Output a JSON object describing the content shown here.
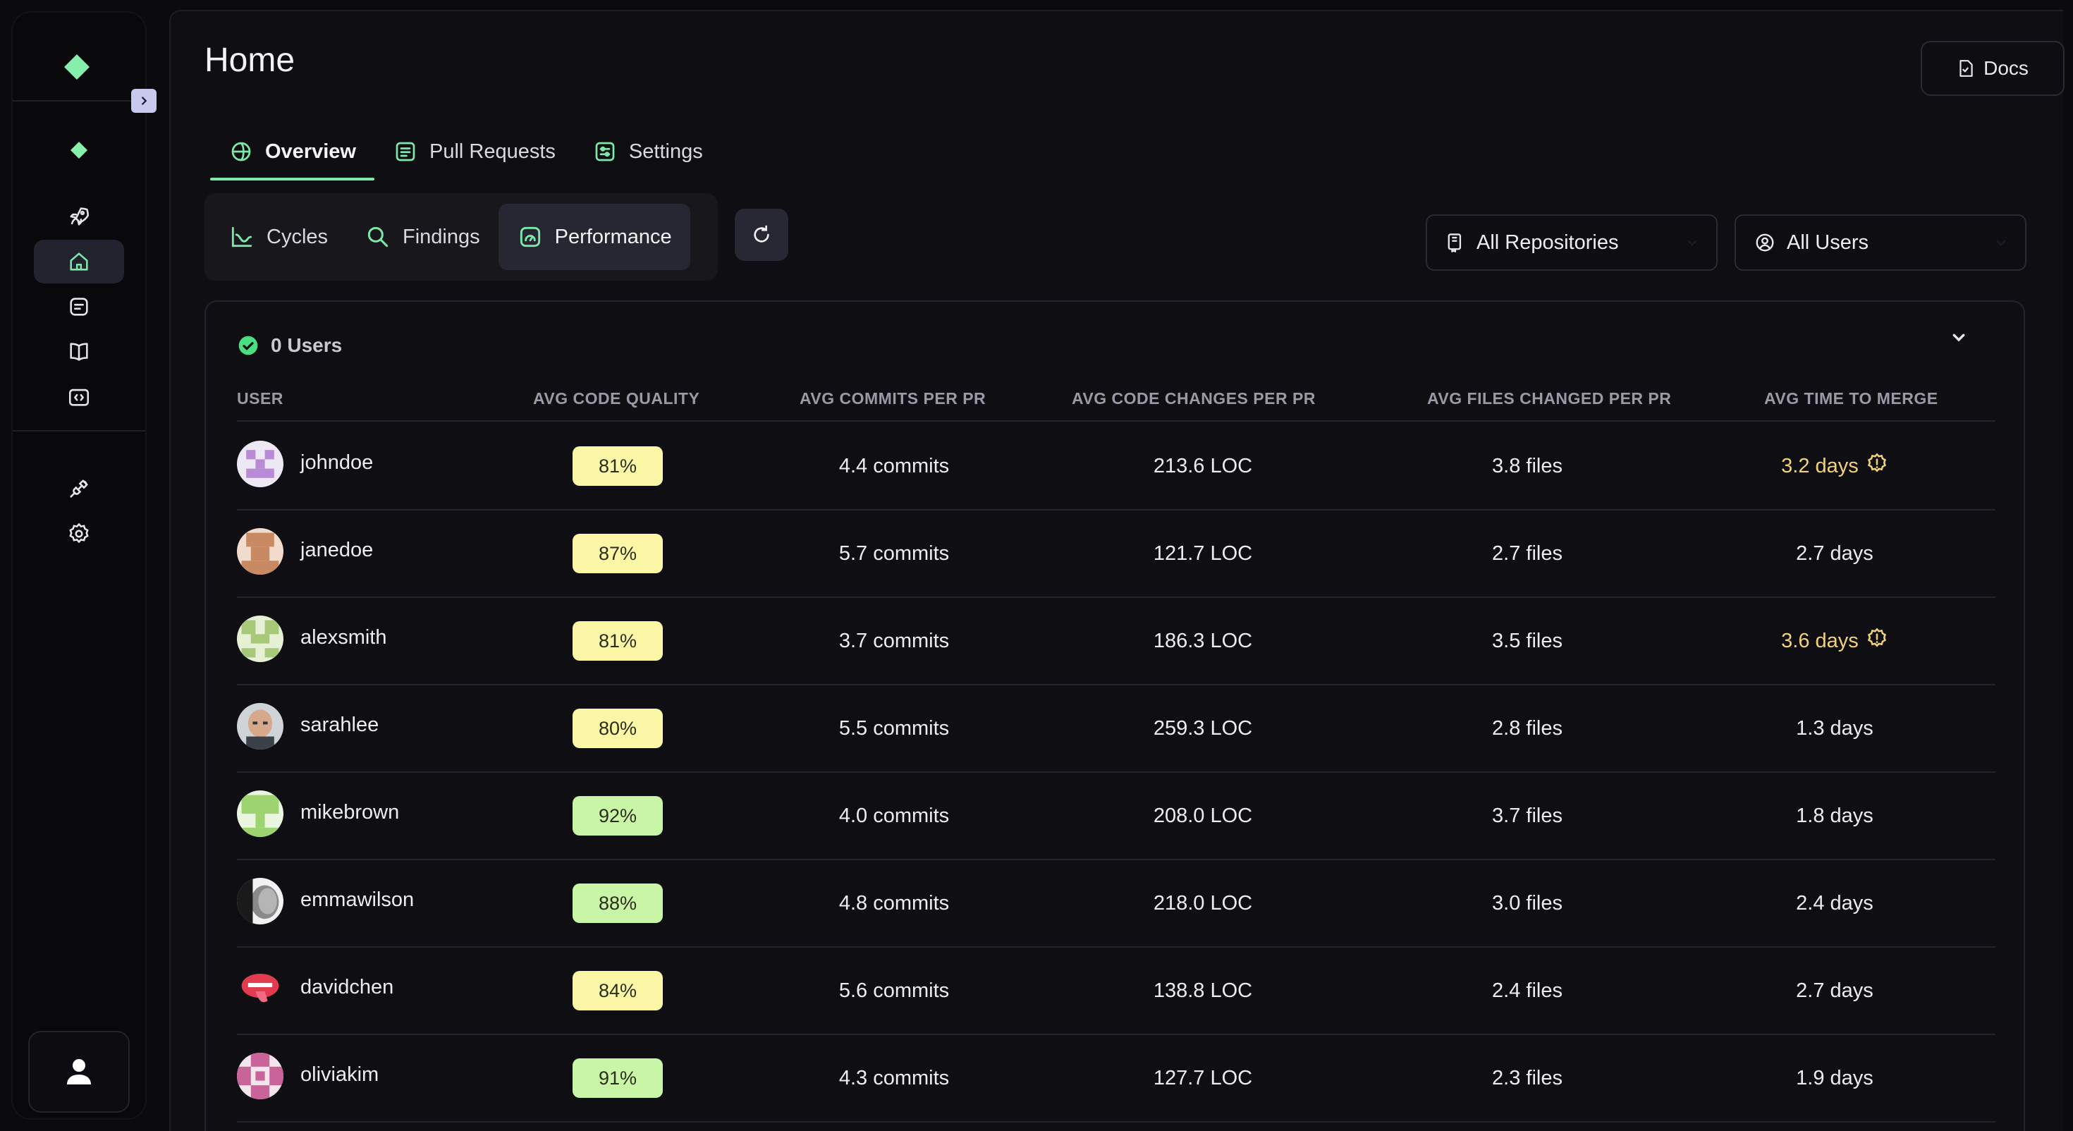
{
  "sidebar": {
    "nav_icons": [
      "logo-icon",
      "diamond-icon",
      "rocket-icon",
      "home-icon",
      "pull-requests-icon",
      "book-icon",
      "code-icon",
      "plug-icon",
      "gear-icon"
    ],
    "user_icon": "person-icon"
  },
  "page": {
    "title": "Home",
    "docs_label": "Docs"
  },
  "tabs": [
    {
      "label": "Overview",
      "active": true
    },
    {
      "label": "Pull Requests",
      "active": false
    },
    {
      "label": "Settings",
      "active": false
    }
  ],
  "segments": [
    {
      "label": "Cycles",
      "active": false
    },
    {
      "label": "Findings",
      "active": false
    },
    {
      "label": "Performance",
      "active": true
    }
  ],
  "filters": {
    "repositories": "All Repositories",
    "users": "All Users"
  },
  "table": {
    "summary": "0 Users",
    "columns": [
      "USER",
      "AVG CODE QUALITY",
      "AVG COMMITS PER PR",
      "AVG CODE CHANGES PER PR",
      "AVG FILES CHANGED PER PR",
      "AVG TIME TO MERGE"
    ],
    "rows": [
      {
        "user": "johndoe",
        "quality": "81%",
        "commits": "4.4 commits",
        "changes": "213.6 LOC",
        "files": "3.8 files",
        "merge": "3.2 days",
        "warn": true
      },
      {
        "user": "janedoe",
        "quality": "87%",
        "commits": "5.7 commits",
        "changes": "121.7 LOC",
        "files": "2.7 files",
        "merge": "2.7 days",
        "warn": false
      },
      {
        "user": "alexsmith",
        "quality": "81%",
        "commits": "3.7 commits",
        "changes": "186.3 LOC",
        "files": "3.5 files",
        "merge": "3.6 days",
        "warn": true
      },
      {
        "user": "sarahlee",
        "quality": "80%",
        "commits": "5.5 commits",
        "changes": "259.3 LOC",
        "files": "2.8 files",
        "merge": "1.3 days",
        "warn": false
      },
      {
        "user": "mikebrown",
        "quality": "92%",
        "commits": "4.0 commits",
        "changes": "208.0 LOC",
        "files": "3.7 files",
        "merge": "1.8 days",
        "warn": false
      },
      {
        "user": "emmawilson",
        "quality": "88%",
        "commits": "4.8 commits",
        "changes": "218.0 LOC",
        "files": "3.0 files",
        "merge": "2.4 days",
        "warn": false
      },
      {
        "user": "davidchen",
        "quality": "84%",
        "commits": "5.6 commits",
        "changes": "138.8 LOC",
        "files": "2.4 files",
        "merge": "2.7 days",
        "warn": false
      },
      {
        "user": "oliviakim",
        "quality": "91%",
        "commits": "4.3 commits",
        "changes": "127.7 LOC",
        "files": "2.3 files",
        "merge": "1.9 days",
        "warn": false
      }
    ]
  },
  "colors": {
    "accent": "#7de8a8",
    "badge_yellow": "#fbf7a6",
    "badge_green": "#c9f5a6",
    "warning": "#f1d27a"
  }
}
